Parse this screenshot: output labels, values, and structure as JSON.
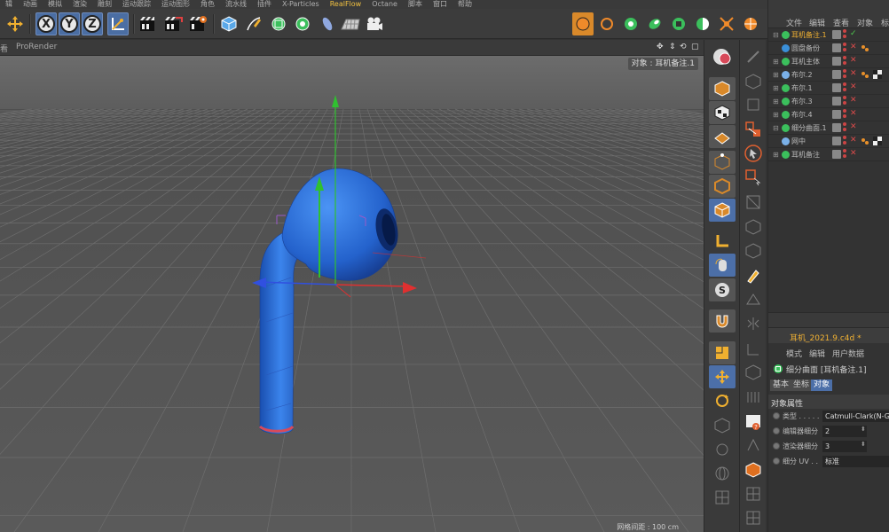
{
  "menubar": {
    "items": [
      "辑",
      "动画",
      "模拟",
      "渲染",
      "雕刻",
      "运动跟踪",
      "运动图形",
      "角色",
      "流水线",
      "插件",
      "X-Particles",
      "RealFlow",
      "Octane",
      "脚本",
      "窗口",
      "帮助"
    ]
  },
  "toolbar": {
    "x_label": "X",
    "y_label": "Y",
    "z_label": "Z"
  },
  "viewport": {
    "menu_left": "看",
    "menu_renderer": "ProRender",
    "object_label": "对象 : 耳机备注.1",
    "scale_text": "网格间距 : 100 cm",
    "colors": {
      "earphone": "#2d6fd6",
      "ring": "#d84a5a",
      "x_axis": "#e03030",
      "y_axis": "#30c030",
      "z_axis": "#3050e0"
    }
  },
  "object_manager": {
    "menu": [
      "文件",
      "编辑",
      "查看",
      "对象",
      "标"
    ],
    "rows": [
      {
        "name": "耳机备注.1",
        "selected": true,
        "icon_color": "#3bbf5c",
        "expand": "⊟",
        "check": "✓"
      },
      {
        "name": "圆盘备份",
        "selected": false,
        "icon_color": "#3a8fd8",
        "expand": "",
        "check": "✕"
      },
      {
        "name": "耳机主体",
        "selected": false,
        "icon_color": "#3bbf5c",
        "expand": "⊞",
        "check": "✕"
      },
      {
        "name": "布尔.2",
        "selected": false,
        "icon_color": "#7ab0e8",
        "expand": "⊞",
        "check": "✕"
      },
      {
        "name": "布尔.1",
        "selected": false,
        "icon_color": "#3bbf5c",
        "expand": "⊞",
        "check": "✕"
      },
      {
        "name": "布尔.3",
        "selected": false,
        "icon_color": "#3bbf5c",
        "expand": "⊞",
        "check": "✕"
      },
      {
        "name": "布尔.4",
        "selected": false,
        "icon_color": "#3bbf5c",
        "expand": "⊞",
        "check": "✕"
      },
      {
        "name": "细分曲面.1",
        "selected": false,
        "icon_color": "#3bbf5c",
        "expand": "⊟",
        "check": "✕"
      },
      {
        "name": "网中",
        "selected": false,
        "icon_color": "#7ab0e8",
        "expand": "",
        "check": "✕"
      },
      {
        "name": "耳机备注",
        "selected": false,
        "icon_color": "#3bbf5c",
        "expand": "⊞",
        "check": "✕"
      }
    ]
  },
  "attribute_manager": {
    "file_title": "耳机_2021.9.c4d *",
    "menu": [
      "模式",
      "编辑",
      "用户数据"
    ],
    "object_line": "细分曲面 [耳机备注.1]",
    "tabs": [
      "基本",
      "坐标",
      "对象"
    ],
    "active_tab": "对象",
    "section": "对象属性",
    "fields": [
      {
        "label": "类型 . . . . .",
        "value": "Catmull-Clark(N-G",
        "numeric": false
      },
      {
        "label": "编辑器细分",
        "value": "2",
        "numeric": true
      },
      {
        "label": "渲染器细分",
        "value": "3",
        "numeric": true
      },
      {
        "label": "细分 UV . .",
        "value": "标准",
        "numeric": false
      }
    ]
  }
}
